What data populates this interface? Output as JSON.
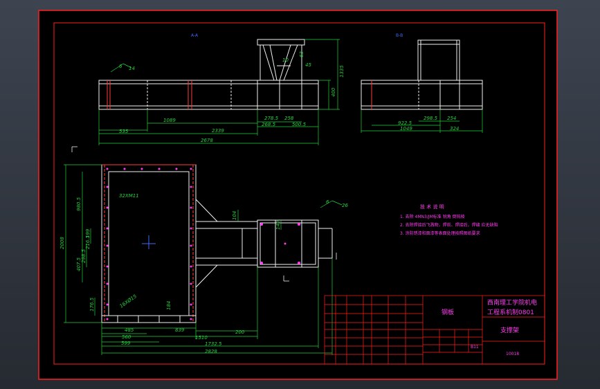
{
  "drawing": {
    "colors": {
      "background": "#000000",
      "frame": "#ff2020",
      "part": "#f2f2f2",
      "dimension": "#22d33a",
      "text": "#ff3df0",
      "label": "#3b6cff",
      "hidden": "#ff3b3b"
    },
    "views": {
      "front_label": "A-A",
      "side_label": "B-B"
    },
    "dims_front": {
      "d535": "535",
      "d1089": "1089",
      "d2339": "2339",
      "d2678": "2678",
      "d2785": "278.5",
      "d258": "258",
      "d2685": "268.5",
      "d5005": "500.5",
      "d400": "400",
      "d1335": "1335",
      "d10": "10",
      "d45": "45",
      "d63": "63",
      "weld": "6",
      "weld_size": "14"
    },
    "dims_side": {
      "d2985": "298.5",
      "d254": "254",
      "d9225": "922.5",
      "d1049": "1049",
      "d324": "324"
    },
    "dims_plan": {
      "d2008": "2008",
      "d9805": "980.5",
      "d4075": "407.5",
      "d2985": "298.5",
      "d2165": "216.5",
      "d199": "199",
      "d1765": "176.5",
      "d485": "485",
      "d560": "560",
      "d599": "599",
      "d839": "839",
      "d1510": "1510",
      "d17325": "1732.5",
      "d2828": "2828",
      "d200": "200",
      "d104": "104",
      "d140": "140",
      "d184": "184",
      "holes1": "32XM11",
      "holes2": "16XØ15",
      "weld": "6",
      "weld_size": "26"
    },
    "tech": {
      "title": "技 术 说 明",
      "lines": [
        "1. 去除 4MN3/JM标准 锐角 倒钝棱",
        "2. 去除焊接后飞溅物，焊前、焊接后，焊缝 应无缺陷",
        "3. 涂防锈漆和面漆等表面处理按照图纸要求"
      ]
    },
    "title_block": {
      "school": "西南理工学院机电",
      "dept": "工程系机制0801",
      "part_name": "支撑架",
      "drawing_no": "10018",
      "material": "钢板",
      "tag": "B11"
    }
  }
}
